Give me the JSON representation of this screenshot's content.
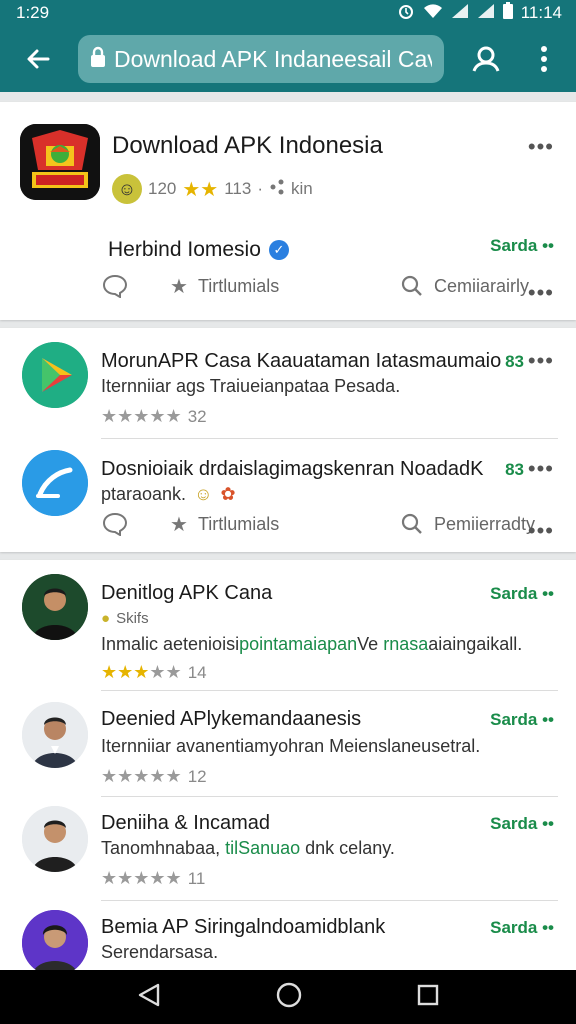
{
  "status": {
    "left_time": "1:29",
    "right_time": "11:14"
  },
  "appbar": {
    "url": "Download APK Indaneesail Cav"
  },
  "header": {
    "title": "Download APK Indonesia",
    "rating_text": "120",
    "rating_count": "113",
    "extra": "kin",
    "section_name": "Herbind Iomesio",
    "link": "Sarda",
    "action1": "Tirtlumials",
    "action2": "Cemiiarairly"
  },
  "apps": [
    {
      "title": "MorunAPR Casa Kaauataman Iatasmaumaio",
      "desc": "Iternniiar ags Traiueianpataa Pesada.",
      "rating": "32",
      "badge": "83"
    },
    {
      "title": "Dosnioiaik drdaislagimagskenran NoadadK",
      "desc": "ptaraoank.",
      "badge": "83"
    }
  ],
  "app_actions": {
    "action1": "Tirtlumials",
    "action2": "Pemiierradty"
  },
  "people": [
    {
      "title": "Denitlog APK Cana",
      "sub": "Skifs",
      "desc_pre": "Inmalic aetenioisi",
      "desc_hl": "pointamaiapan",
      "desc_mid": "Ve ",
      "desc_hl2": "rnasa",
      "desc_post": "aiaingaikall.",
      "rating": "14",
      "badge": "Sarda"
    },
    {
      "title": "Deenied APlykemandaanesis",
      "desc": "Iternniiar avanentiamyohran Meienslaneusetral.",
      "rating": "12",
      "badge": "Sarda"
    },
    {
      "title": "Deniiha & Incamad",
      "desc_pre": "Tanomhnabaa, ",
      "desc_hl": "tilSanuao",
      "desc_post": " dnk celany.",
      "rating": "11",
      "badge": "Sarda"
    },
    {
      "title": "Bemia AP Siringalndoamidblank",
      "desc": "Serendarsasa.",
      "badge": "Sarda"
    }
  ]
}
